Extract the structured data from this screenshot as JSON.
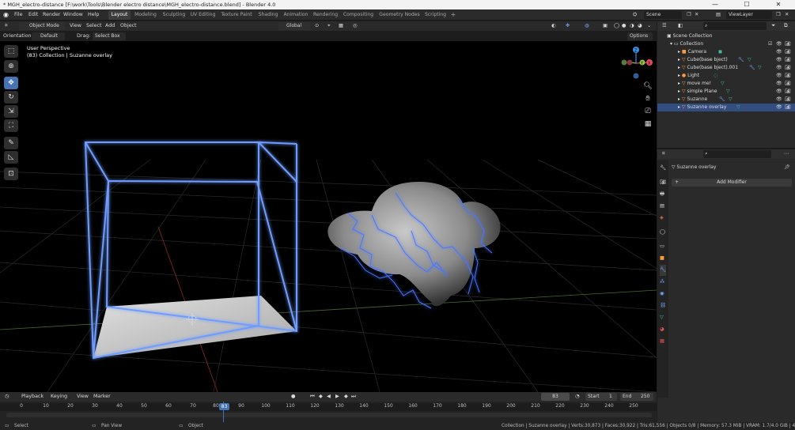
{
  "window": {
    "title": "* MGH_electro-distance [F:\\work\\Tools\\Blender electro distance\\MGH_electro-distance.blend] - Blender 4.0",
    "minimize": "—",
    "maximize": "☐",
    "close": "✕"
  },
  "menubar": {
    "items": [
      "File",
      "Edit",
      "Render",
      "Window",
      "Help"
    ]
  },
  "workspaces": {
    "tabs": [
      "Layout",
      "Modeling",
      "Sculpting",
      "UV Editing",
      "Texture Paint",
      "Shading",
      "Animation",
      "Rendering",
      "Compositing",
      "Geometry Nodes",
      "Scripting"
    ],
    "active": "Layout",
    "add": "+"
  },
  "scene": {
    "name": "Scene",
    "view_layer": "ViewLayer"
  },
  "viewport_header": {
    "mode": "Object Mode",
    "menus": [
      "View",
      "Select",
      "Add",
      "Object"
    ],
    "transform_orientation": "Global"
  },
  "tool_options": {
    "orientation_label": "Orientation:",
    "orientation_value": "Default",
    "drag_label": "Drag:",
    "drag_value": "Select Box",
    "options": "Options"
  },
  "viewport": {
    "view_name": "User Perspective",
    "context": "(83) Collection | Suzanne overlay",
    "gizmo_axes": {
      "x": "X",
      "y": "Y",
      "z": "Z"
    },
    "colors": {
      "x": "#e64b5d",
      "y": "#8cc63f",
      "z": "#3c8ee6",
      "cube_glow": "#5b8cff",
      "lightning": "#4a74ff"
    }
  },
  "outliner": {
    "root": "Scene Collection",
    "collection": "Collection",
    "items": [
      {
        "name": "Camera"
      },
      {
        "name": "Cube(base bject)"
      },
      {
        "name": "Cube(base bject).001"
      },
      {
        "name": "Light"
      },
      {
        "name": "move me!"
      },
      {
        "name": "simple Plane"
      },
      {
        "name": "Suzanne"
      },
      {
        "name": "Suzanne overlay"
      }
    ]
  },
  "properties": {
    "object_name": "Suzanne overlay",
    "add_modifier": "Add Modifier"
  },
  "timeline": {
    "menus": [
      "Playback",
      "Keying",
      "View",
      "Marker"
    ],
    "current_frame": "83",
    "start_label": "Start",
    "start": "1",
    "end_label": "End",
    "end": "250",
    "ticks": [
      "0",
      "10",
      "20",
      "30",
      "40",
      "50",
      "60",
      "70",
      "80",
      "90",
      "100",
      "110",
      "120",
      "130",
      "140",
      "150",
      "160",
      "170",
      "180",
      "190",
      "200",
      "210",
      "220",
      "230",
      "240",
      "250"
    ]
  },
  "statusbar": {
    "select": "Select",
    "pan_view": "Pan View",
    "object": "Object",
    "stats": "Collection | Suzanne overlay | Verts:30,873 | Faces:30,922 | Tris:61,556 | Objects 0/8 | Memory: 57.3 MiB | VRAM: 1.7/4.0 GiB | 4.0.1"
  }
}
